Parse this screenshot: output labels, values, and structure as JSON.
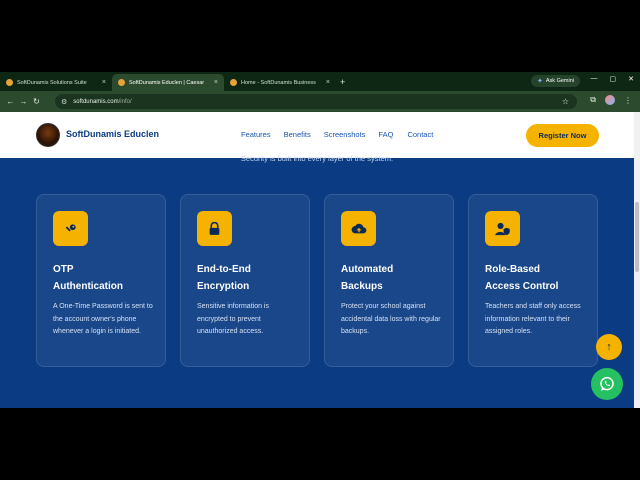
{
  "browser": {
    "tabs": [
      {
        "label": "SoftDunamis Solutions Suite",
        "favicon_color": "#e8a23a"
      },
      {
        "label": "SoftDunamis Educlen | Caesar",
        "favicon_color": "#e8a23a"
      },
      {
        "label": "Home - SoftDunamis Business",
        "favicon_color": "#e8a23a"
      }
    ],
    "active_tab": 1,
    "gemini_label": "Ask Gemini",
    "url_main": "softdunamis.com",
    "url_path": "/info/"
  },
  "header": {
    "brand": "SoftDunamis Educlen",
    "nav": [
      "Features",
      "Benefits",
      "Screenshots",
      "FAQ",
      "Contact"
    ],
    "register_label": "Register Now"
  },
  "section": {
    "subtitle": "Security is built into every layer of the system.",
    "cards": [
      {
        "icon": "key-icon",
        "title_line1": "OTP",
        "title_line2": "Authentication",
        "desc": "A One-Time Password is sent to the account owner's phone whenever a login is initiated."
      },
      {
        "icon": "lock-icon",
        "title_line1": "End-to-End",
        "title_line2": "Encryption",
        "desc": "Sensitive information is encrypted to prevent unauthorized access."
      },
      {
        "icon": "cloud-upload-icon",
        "title_line1": "Automated",
        "title_line2": "Backups",
        "desc": "Protect your school against accidental data loss with regular backups."
      },
      {
        "icon": "user-shield-icon",
        "title_line1": "Role-Based",
        "title_line2": "Access Control",
        "desc": "Teachers and staff only access information relevant to their assigned roles."
      }
    ]
  },
  "colors": {
    "accent": "#f5b300",
    "page_bg": "#0b3c83",
    "whatsapp": "#25c062"
  }
}
